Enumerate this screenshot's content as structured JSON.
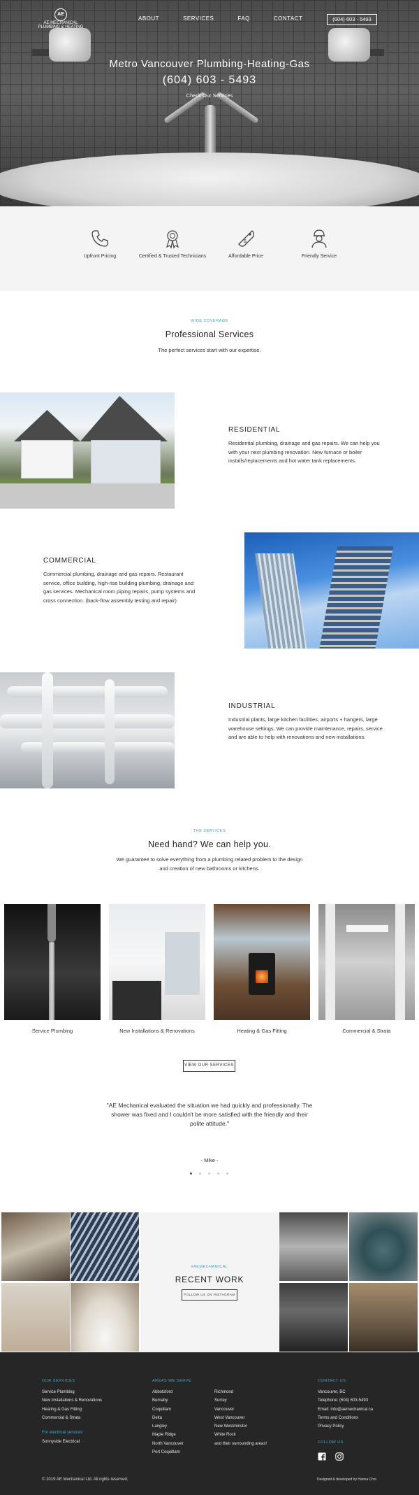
{
  "brand": {
    "logo_mark": "AE",
    "logo_line1": "AE MECHANICAL",
    "logo_line2": "PLUMBING & HEATING"
  },
  "nav": {
    "items": [
      "ABOUT",
      "SERVICES",
      "FAQ",
      "CONTACT"
    ],
    "phone_button": "(604) 603 - 5493"
  },
  "hero": {
    "title": "Metro Vancouver Plumbing-Heating-Gas",
    "phone": "(604) 603 - 5493",
    "cta": "Check Our Services"
  },
  "features": [
    {
      "icon": "phone-icon",
      "label": "Upfront Pricing"
    },
    {
      "icon": "award-icon",
      "label": "Certified & Trusted Technicians"
    },
    {
      "icon": "price-tag-icon",
      "label": "Affordable Price"
    },
    {
      "icon": "technician-icon",
      "label": "Friendly Service"
    }
  ],
  "professional": {
    "kicker": "WIDE COVERAGE",
    "title": "Professional Services",
    "subtitle": "The perfect services start with our expertise."
  },
  "services": [
    {
      "title": "RESIDENTIAL",
      "text": "Residential plumbing, drainage and gas repairs. We can help you with your next plumbing renovation. New furnace or boiler installs/replacements and hot water tank replacements."
    },
    {
      "title": "COMMERCIAL",
      "text": "Commercial plumbing, drainage and gas repairs. Restaurant service, office building, high-rise building plumbing, drainage and gas services. Mechanical room piping repairs, pump systems and cross connection. (back-flow assembly testing and repair)"
    },
    {
      "title": "INDUSTRIAL",
      "text": "Industrial plants, large kitchen facilities, airports + hangers, large warehouse settings. We can provide maintenance, repairs, service and are able to help with renovations and new installations."
    }
  ],
  "help": {
    "kicker": "THE SERVICES",
    "title": "Need hand? We can help you.",
    "text": "We guarantee to solve everything from a plumbing related problem to the design and creation of new bathrooms or kitchens."
  },
  "cards": [
    "Service Plumbing",
    "New Installations & Renovations",
    "Heating & Gas Fitting",
    "Commercial & Strata"
  ],
  "view_services_button": "VIEW OUR SERVICES",
  "testimonial": {
    "quote": "\"AE Mechanical evaluated the situation we had quickly and professionally. The shower was fixed and I couldn't be more satisfied with the friendly and their polite attitude.\"",
    "author": "- Mike -",
    "active_dot": 0
  },
  "recent": {
    "kicker": "#AEMECHANICAL",
    "title": "RECENT WORK",
    "button": "FOLLOW US ON INSTAGRAM"
  },
  "footer": {
    "services_heading": "OUR SERVICES",
    "services": [
      "Service Plumbing",
      "New Installations & Renovations",
      "Heating & Gas Fitting",
      "Commercial & Strata"
    ],
    "electrical_heading": "For electrical services:",
    "electrical": "Sunnyside Electrical",
    "areas_heading": "AREAS WE SERVE",
    "areas_col1": [
      "Abbotsford",
      "Burnaby",
      "Coquitlam",
      "Delta",
      "Langley",
      "Maple Ridge",
      "North Vancouver",
      "Port Coquitlam"
    ],
    "areas_col2": [
      "Richmond",
      "Surrey",
      "Vancouver",
      "West Vancouver",
      "New Westminster",
      "White Rock",
      "and their surrounding areas!"
    ],
    "contact_heading": "CONTACT US",
    "contact": [
      "Vancouver, BC",
      "Telephone: (604) 603-5493",
      "Email: info@aemechanical.ca",
      "Terms and Conditions",
      "Privacy Policy"
    ],
    "follow_heading": "FOLLOW US",
    "copyright": "© 2019 AE Mechanical Ltd. All rights reserved.",
    "credit": "Designed & developed by Hanna Choi"
  },
  "colors": {
    "accent": "#42a5c8",
    "footer_bg": "#262626",
    "features_bg": "#f4f4f4"
  }
}
